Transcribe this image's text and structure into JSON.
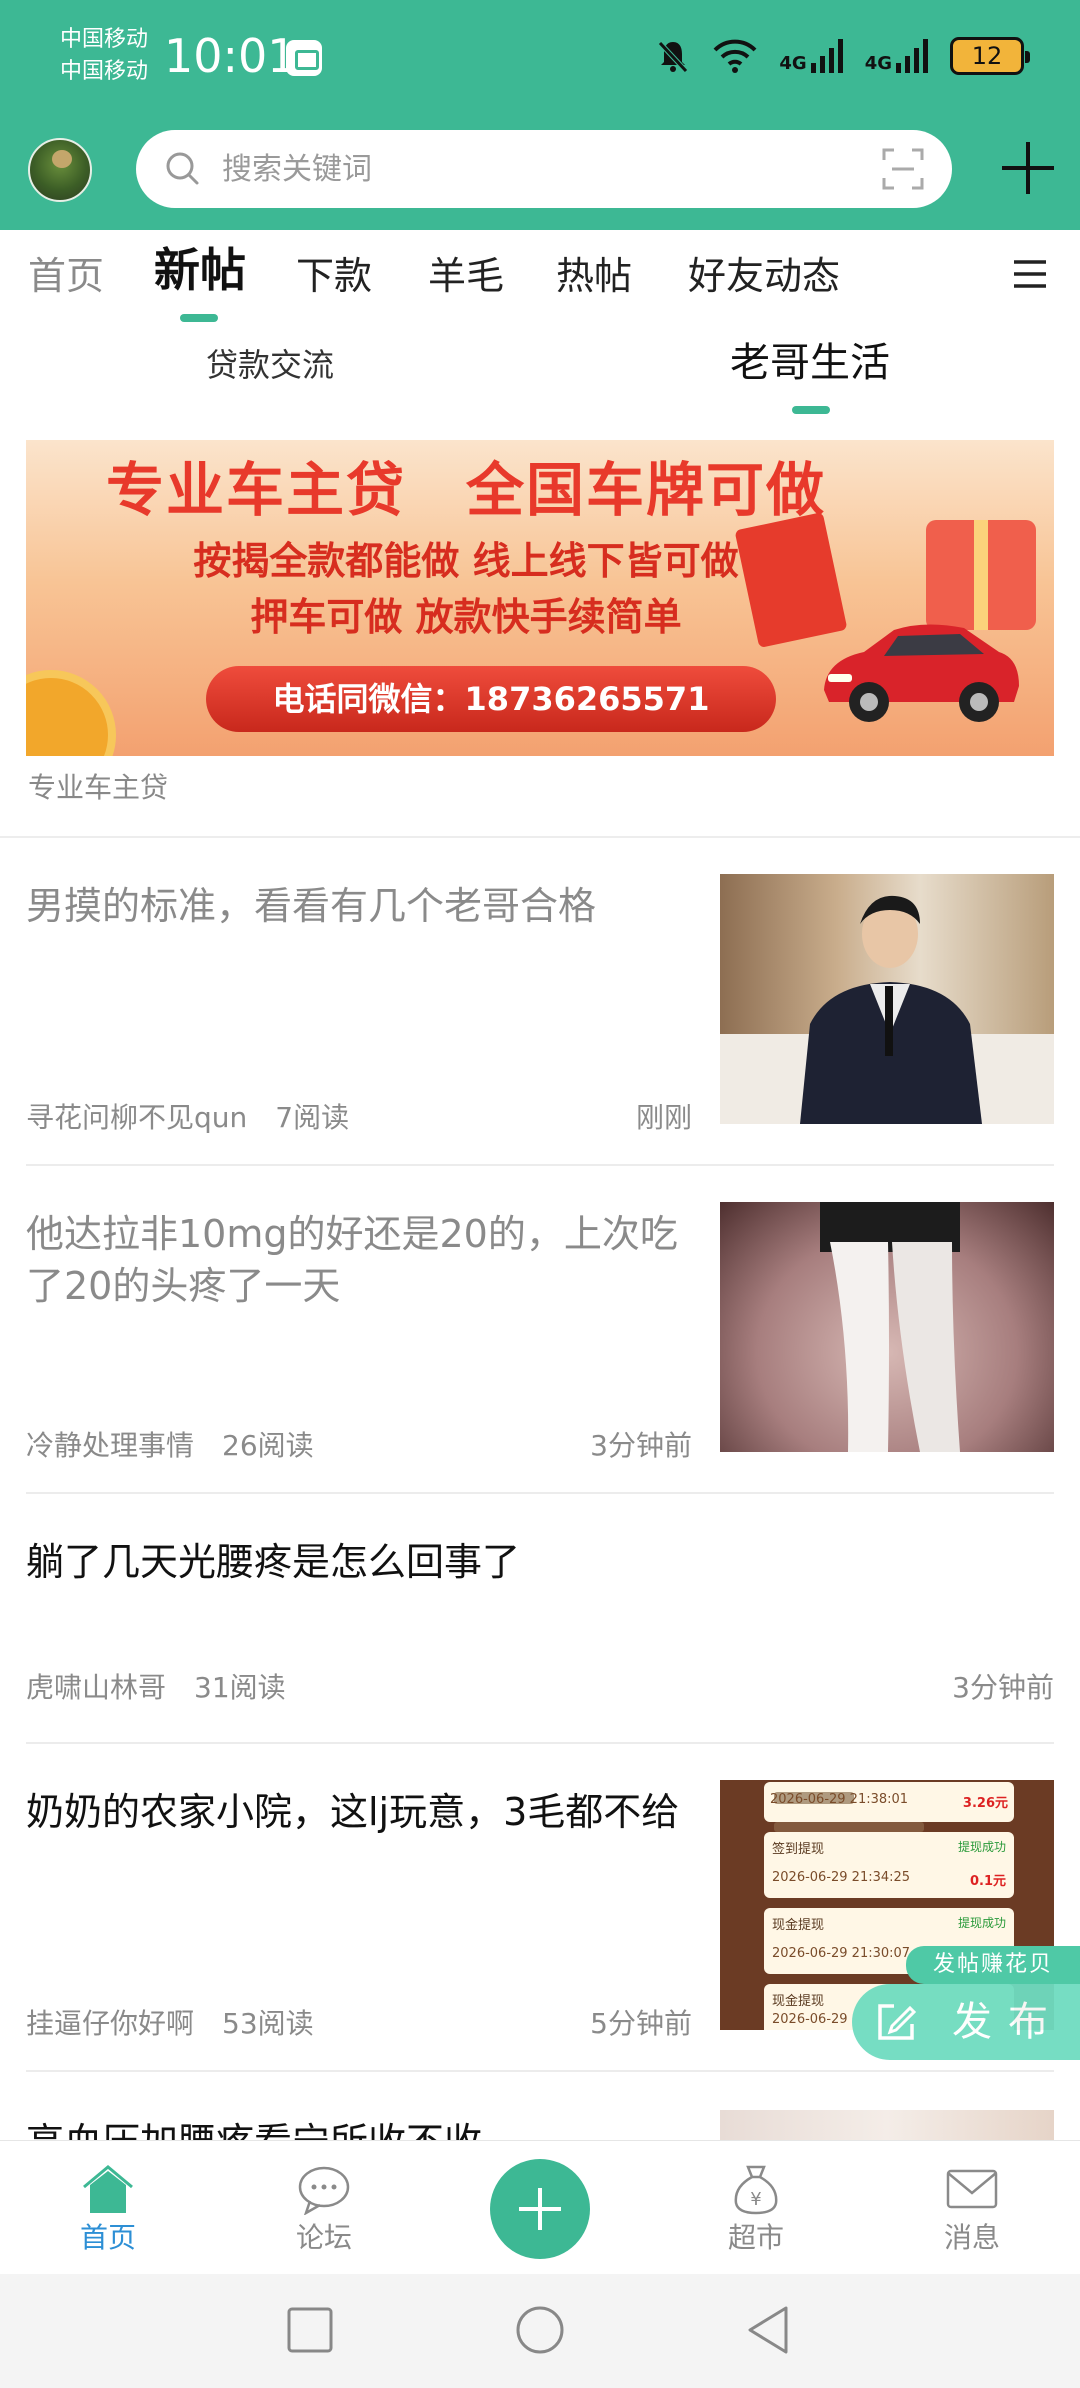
{
  "status_bar": {
    "carrier_1": "中国移动",
    "carrier_2": "中国移动",
    "time": "10:01",
    "network_1": "4G",
    "network_2": "4G",
    "battery": "12"
  },
  "header": {
    "search_placeholder": "搜索关键词",
    "accent_color": "#3db894"
  },
  "main_tabs": [
    {
      "label": "首页"
    },
    {
      "label": "新帖"
    },
    {
      "label": "下款"
    },
    {
      "label": "羊毛"
    },
    {
      "label": "热帖"
    },
    {
      "label": "好友动态"
    }
  ],
  "sub_tabs": [
    {
      "label": "贷款交流"
    },
    {
      "label": "老哥生活"
    }
  ],
  "banner": {
    "title": "专业车主贷　全国车牌可做",
    "line1": "按揭全款都能做 线上线下皆可做",
    "line2": "押车可做 放款快手续简单",
    "phone": "电话同微信：18736265571",
    "caption": "专业车主贷"
  },
  "feed": [
    {
      "title": "男摸的标准，看看有几个老哥合格",
      "author": "寻花问柳不见qun",
      "reads": "7阅读",
      "time": "刚刚",
      "has_thumb": true
    },
    {
      "title": "他达拉非10mg的好还是20的，上次吃了20的头疼了一天",
      "author": "冷静处理事情",
      "reads": "26阅读",
      "time": "3分钟前",
      "has_thumb": true
    },
    {
      "title": "躺了几天光腰疼是怎么回事了",
      "author": "虎啸山林哥",
      "reads": "31阅读",
      "time": "3分钟前",
      "has_thumb": false
    },
    {
      "title": "奶奶的农家小院，这lj玩意，3毛都不给",
      "author": "挂逼仔你好啊",
      "reads": "53阅读",
      "time": "5分钟前",
      "has_thumb": true
    },
    {
      "title": "高血压加腰疼看宁所收不收",
      "has_thumb": true
    }
  ],
  "thumb4_records": [
    {
      "time": "2026-06-29 21:38:01",
      "amount": "3.26元"
    },
    {
      "label": "签到提现",
      "status": "提现成功",
      "time": "2026-06-29 21:34:25",
      "amount": "0.1元"
    },
    {
      "label": "现金提现",
      "status": "提现成功",
      "time": "2026-06-29 21:30:07"
    },
    {
      "label": "现金提现",
      "time": "2026-06-29"
    }
  ],
  "floating": {
    "earn_tag": "发帖赚花贝",
    "publish_label": "发布"
  },
  "bottom_nav": [
    {
      "label": "首页",
      "icon": "home-icon"
    },
    {
      "label": "论坛",
      "icon": "chat-bubble-icon"
    },
    {
      "label": "超市",
      "icon": "money-bag-icon"
    },
    {
      "label": "消息",
      "icon": "envelope-icon"
    }
  ],
  "nav_active_color": "#2d8fd5"
}
